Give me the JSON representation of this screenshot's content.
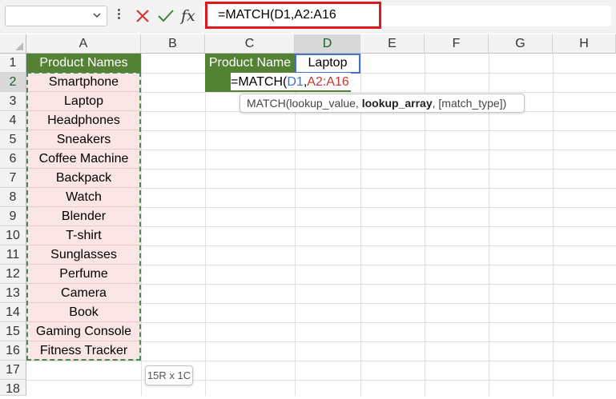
{
  "formula_bar": {
    "name_box_value": "",
    "formula": "=MATCH(D1,A2:A16",
    "fx_label": "fx"
  },
  "columns": [
    "A",
    "B",
    "C",
    "D",
    "E",
    "F",
    "G",
    "H"
  ],
  "rows": [
    "1",
    "2",
    "3",
    "4",
    "5",
    "6",
    "7",
    "8",
    "9",
    "10",
    "11",
    "12",
    "13",
    "14",
    "15",
    "16",
    "17",
    "18"
  ],
  "cells": {
    "A1": "Product Names",
    "products": [
      "Smartphone",
      "Laptop",
      "Headphones",
      "Sneakers",
      "Coffee Machine",
      "Backpack",
      "Watch",
      "Blender",
      "T-shirt",
      "Sunglasses",
      "Perfume",
      "Camera",
      "Book",
      "Gaming Console",
      "Fitness Tracker"
    ],
    "C1": "Product Name",
    "D1": "Laptop",
    "C2_formula_parts": {
      "prefix": "=MATCH(",
      "ref1": "D1",
      "comma": ",",
      "ref2": "A2:A16"
    }
  },
  "tooltip": {
    "fn": "MATCH(",
    "arg1": "lookup_value",
    "sep1": ", ",
    "arg2": "lookup_array",
    "sep2": ", ",
    "arg3": "[match_type]",
    "close": ")"
  },
  "selection_size": "15R x 1C",
  "colors": {
    "header_green": "#548235",
    "ref_blue": "#4472c4",
    "ref_red": "#c0392b",
    "highlight_red": "#e0191f",
    "pink": "#fbe5e5"
  }
}
